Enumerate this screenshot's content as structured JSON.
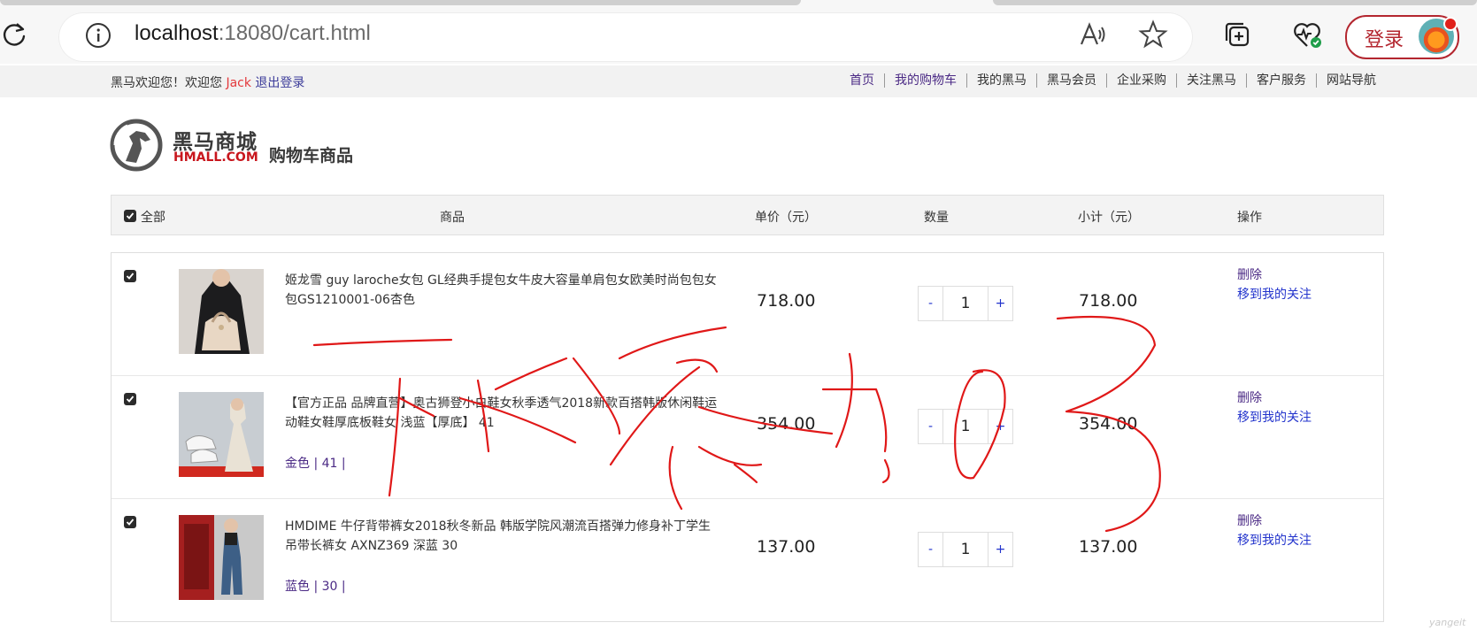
{
  "browser": {
    "url_host": "localhost",
    "url_rest": ":18080/cart.html",
    "login_label": "登录",
    "icons": [
      "reload-icon",
      "site-info-icon",
      "read-aloud-icon",
      "favorite-star-icon",
      "collections-icon",
      "browser-essentials-icon",
      "profile-avatar-icon"
    ]
  },
  "topbar": {
    "welcome_prefix": "黑马欢迎您！欢迎您",
    "username": "Jack",
    "logout": "退出登录",
    "nav": [
      "首页",
      "我的购物车",
      "我的黑马",
      "黑马会员",
      "企业采购",
      "关注黑马",
      "客户服务",
      "网站导航"
    ]
  },
  "header": {
    "logo_cn": "黑马商城",
    "logo_en": "HMALL.COM",
    "page_title": "购物车商品"
  },
  "table": {
    "select_all": "全部",
    "columns": [
      "商品",
      "单价（元）",
      "数量",
      "小计（元）",
      "操作"
    ],
    "items": [
      {
        "name": "姬龙雪 guy laroche女包 GL经典手提包女牛皮大容量单肩包女欧美时尚包包女包GS1210001-06杏色",
        "attrs": "",
        "price": "718.00",
        "qty": "1",
        "subtotal": "718.00",
        "delete": "删除",
        "favorite": "移到我的关注"
      },
      {
        "name": "【官方正品 品牌直营】奥古狮登小白鞋女秋季透气2018新款百搭韩版休闲鞋运动鞋女鞋厚底板鞋女 浅蓝【厚底】 41",
        "attrs": "金色 | 41 |",
        "price": "354.00",
        "qty": "1",
        "subtotal": "354.00",
        "delete": "删除",
        "favorite": "移到我的关注"
      },
      {
        "name": "HMDIME 牛仔背带裤女2018秋冬新品 韩版学院风潮流百搭弹力修身补丁学生吊带长裤女 AXNZ369 深蓝 30",
        "attrs": "蓝色 | 30 |",
        "price": "137.00",
        "qty": "1",
        "subtotal": "137.00",
        "delete": "删除",
        "favorite": "移到我的关注"
      }
    ],
    "qty_minus": "-",
    "qty_plus": "+"
  },
  "watermark": "yangeit",
  "colors": {
    "accent_red": "#e4393c",
    "link_purple": "#4b2a85",
    "link_blue": "#2233cc",
    "scribble_red": "#e01818"
  }
}
